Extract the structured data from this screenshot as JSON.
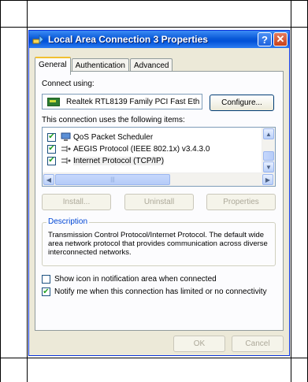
{
  "window": {
    "title": "Local Area Connection 3 Properties",
    "help_button": "?",
    "close_button": "✕"
  },
  "tabs": [
    {
      "label": "General"
    },
    {
      "label": "Authentication"
    },
    {
      "label": "Advanced"
    }
  ],
  "general": {
    "connect_using_label": "Connect using:",
    "adapter_name": "Realtek RTL8139 Family PCI Fast Eth",
    "configure_button": "Configure...",
    "items_label": "This connection uses the following items:",
    "items": [
      {
        "label": "QoS Packet Scheduler",
        "checked": true,
        "icon": "qos-icon"
      },
      {
        "label": "AEGIS Protocol (IEEE 802.1x) v3.4.3.0",
        "checked": true,
        "icon": "network-protocol-icon"
      },
      {
        "label": "Internet Protocol (TCP/IP)",
        "checked": true,
        "icon": "network-protocol-icon"
      }
    ],
    "install_button": "Install...",
    "uninstall_button": "Uninstall",
    "properties_button": "Properties",
    "description_legend": "Description",
    "description_text": "Transmission Control Protocol/Internet Protocol. The default wide area network protocol that provides communication across diverse interconnected networks.",
    "show_icon_label": "Show icon in notification area when connected",
    "show_icon_checked": false,
    "notify_label": "Notify me when this connection has limited or no connectivity",
    "notify_checked": true
  },
  "footer": {
    "ok_button": "OK",
    "cancel_button": "Cancel"
  }
}
